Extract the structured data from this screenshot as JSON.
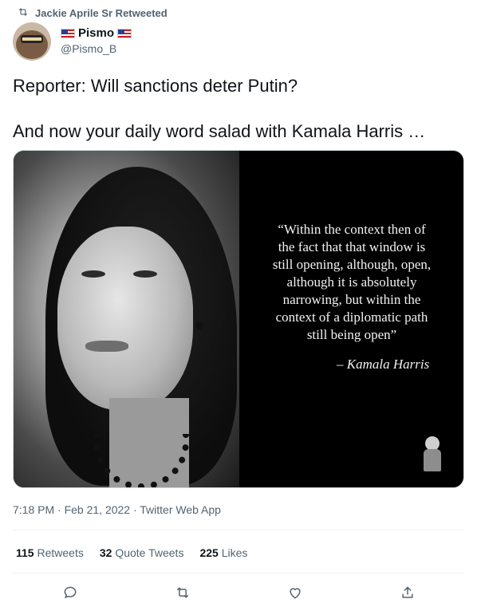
{
  "retweet_context": {
    "text": "Jackie Aprile Sr Retweeted",
    "icon": "retweet-icon"
  },
  "author": {
    "name": "Pismo",
    "handle": "@Pismo_B",
    "name_decorations": [
      "us-flag-emoji",
      "us-flag-emoji"
    ]
  },
  "tweet": {
    "lines": [
      "Reporter: Will sanctions deter Putin?",
      "And now your daily word salad with Kamala Harris …"
    ]
  },
  "media": {
    "quote_lines": [
      "“Within the context then of",
      "the fact that that window is",
      "still opening, although, open,",
      "although it is absolutely",
      "narrowing, but within the",
      "context of a diplomatic path",
      "still being open”"
    ],
    "attribution": "– Kamala Harris"
  },
  "meta": {
    "text": "7:18 PM · Feb 21, 2022 · Twitter Web App"
  },
  "stats": [
    {
      "count": "115",
      "label": "Retweets"
    },
    {
      "count": "32",
      "label": "Quote Tweets"
    },
    {
      "count": "225",
      "label": "Likes"
    }
  ],
  "actions": [
    {
      "icon": "reply-icon"
    },
    {
      "icon": "retweet-icon"
    },
    {
      "icon": "like-icon"
    },
    {
      "icon": "share-icon"
    }
  ],
  "colors": {
    "text": "#0f1419",
    "secondary": "#536471",
    "divider": "#eff3f4"
  }
}
